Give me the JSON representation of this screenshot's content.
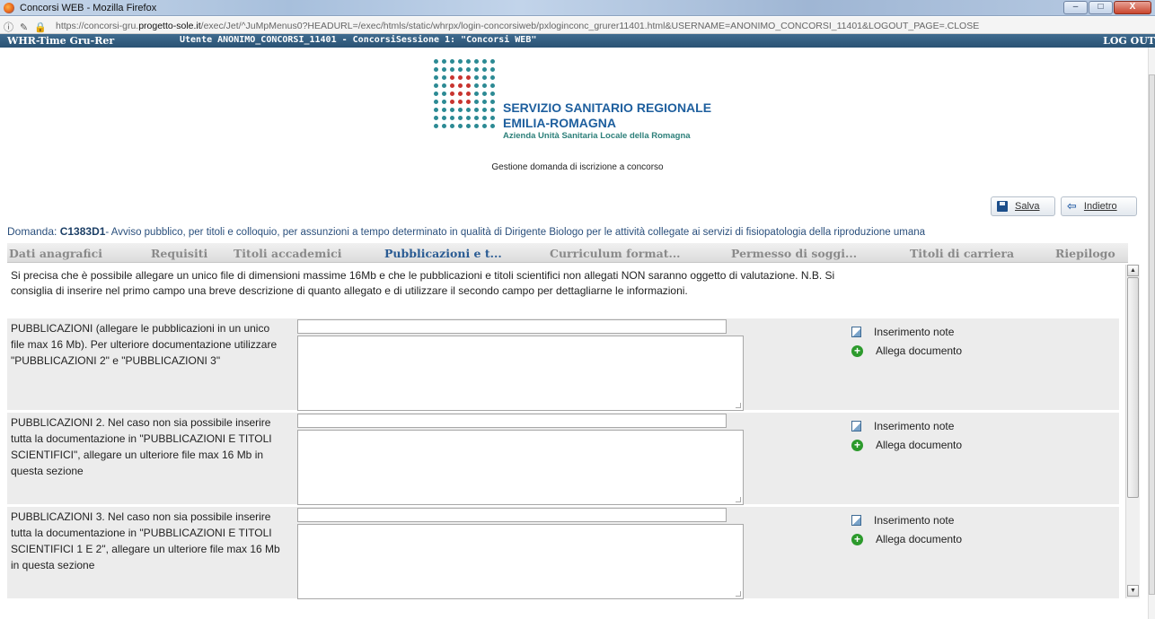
{
  "window": {
    "title": "Concorsi WEB - Mozilla Firefox",
    "minimize": "–",
    "maximize": "□",
    "close": "X"
  },
  "address": {
    "icons": "ⓘ ✎ ",
    "lock": "🔒",
    "url_prefix": "https://concorsi-gru.",
    "url_domain": "progetto-sole.it",
    "url_rest": "/exec/Jet/^JuMpMenus0?HEADURL=/exec/htmls/static/whrpx/login-concorsiweb/pxloginconc_grurer11401.html&USERNAME=ANONIMO_CONCORSI_11401&LOGOUT_PAGE=.CLOSE"
  },
  "appbar": {
    "brand": "WHR-Time Gru-Rer",
    "user": "Utente ANONIMO_CONCORSI_11401 - ConcorsiSessione 1: \"Concorsi WEB\"",
    "logout": "LOG OUT"
  },
  "logo": {
    "line1": "SERVIZIO SANITARIO REGIONALE",
    "line2": "EMILIA-ROMAGNA",
    "line3": "Azienda Unità Sanitaria Locale della Romagna"
  },
  "subtitle": "Gestione domanda di iscrizione a concorso",
  "buttons": {
    "save": "Salva",
    "back": "Indietro"
  },
  "domanda": {
    "label": "Domanda: ",
    "code": "C1383D1",
    "description": "- Avviso pubblico, per titoli e colloquio, per assunzioni a tempo determinato in qualità di Dirigente Biologo per le attività collegate ai servizi di fisiopatologia della riproduzione umana"
  },
  "tabs": [
    {
      "label": "Dati anagrafici"
    },
    {
      "label": "Requisiti"
    },
    {
      "label": "Titoli accademici"
    },
    {
      "label": "Pubblicazioni e t..."
    },
    {
      "label": "Curriculum format..."
    },
    {
      "label": "Permesso di soggi..."
    },
    {
      "label": "Titoli di carriera"
    },
    {
      "label": "Riepilogo"
    }
  ],
  "intro": "Si precisa che è possibile allegare un unico file di dimensioni massime 16Mb e che le pubblicazioni e titoli scientifici non allegati NON saranno oggetto di valutazione. N.B. Si consiglia di inserire nel primo campo una breve descrizione di quanto allegato e di utilizzare il secondo campo per dettagliarne le informazioni.",
  "sections": [
    {
      "label": "PUBBLICAZIONI (allegare le pubblicazioni in un unico file max 16 Mb). Per ulteriore documentazione utilizzare \"PUBBLICAZIONI 2\" e \"PUBBLICAZIONI 3\"",
      "note_action": "Inserimento note",
      "attach_action": "Allega documento"
    },
    {
      "label": "PUBBLICAZIONI 2. Nel caso non sia possibile inserire tutta la documentazione in \"PUBBLICAZIONI E TITOLI SCIENTIFICI\", allegare un ulteriore file max 16 Mb in questa sezione",
      "note_action": "Inserimento note",
      "attach_action": "Allega documento"
    },
    {
      "label": "PUBBLICAZIONI 3. Nel caso non sia possibile inserire tutta la documentazione in \"PUBBLICAZIONI E TITOLI SCIENTIFICI 1 E 2\", allegare un ulteriore file max 16 Mb in questa sezione",
      "note_action": "Inserimento note",
      "attach_action": "Allega documento"
    }
  ],
  "scroll": {
    "up": "▲",
    "down": "▼"
  }
}
